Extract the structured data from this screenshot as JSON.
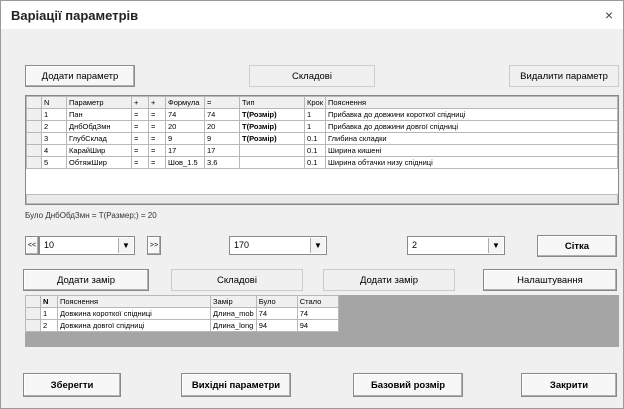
{
  "window": {
    "title": "Варіації параметрів",
    "close_glyph": "×"
  },
  "toolbar": {
    "add_param": "Додати параметр",
    "components": "Складові",
    "delete_param": "Видалити параметр"
  },
  "params_table": {
    "headers": [
      "N",
      "Параметр",
      "+",
      "+",
      "Формула",
      "=",
      "Тип",
      "Крок",
      "Пояснення"
    ],
    "rows": [
      [
        "1",
        "Пан",
        "=",
        "=",
        "74",
        "74",
        "T(Розмір)",
        "1",
        "Прибавка до довжини короткої спідниці"
      ],
      [
        "2",
        "ДнбОбдЗмн",
        "=",
        "=",
        "20",
        "20",
        "T(Розмір)",
        "1",
        "Прибавка до довжини довгої спідниці"
      ],
      [
        "3",
        "ГлубСклад",
        "=",
        "=",
        "9",
        "9",
        "T(Розмір)",
        "0.1",
        "Глибина складки"
      ],
      [
        "4",
        "КарайШир",
        "=",
        "=",
        "17",
        "17",
        "",
        "0.1",
        "Ширина кишені"
      ],
      [
        "5",
        "ОбтяжШир",
        "=",
        "=",
        "Шов_1.5",
        "3.6",
        "",
        "0.1",
        "Ширина обтачки низу спідниці"
      ]
    ]
  },
  "status_text": "Було ДнбОбдЗмн = T(Размер;) = 20",
  "controls": {
    "combo1": "10",
    "prev_glyph": "<<",
    "next_glyph": ">>",
    "combo2": "170",
    "combo3": "2",
    "grid_button": "Сітка",
    "combo_arrow": "▼"
  },
  "actions": {
    "add_measure": "Додати замір",
    "components": "Складові",
    "add_measure2": "Додати замір",
    "settings": "Налаштування"
  },
  "measures_table": {
    "headers": [
      "N",
      "Пояснення",
      "Замір",
      "Було",
      "Стало"
    ],
    "rows": [
      [
        "1",
        "Довжина короткої спідниці",
        "Длина_mob",
        "74",
        "74"
      ],
      [
        "2",
        "Довжина довгої спідниці",
        "Длина_long",
        "94",
        "94"
      ]
    ]
  },
  "footer": {
    "save": "Зберегти",
    "input_params": "Вихідні параметри",
    "base_size": "Базовий розмір",
    "close": "Закрити"
  }
}
